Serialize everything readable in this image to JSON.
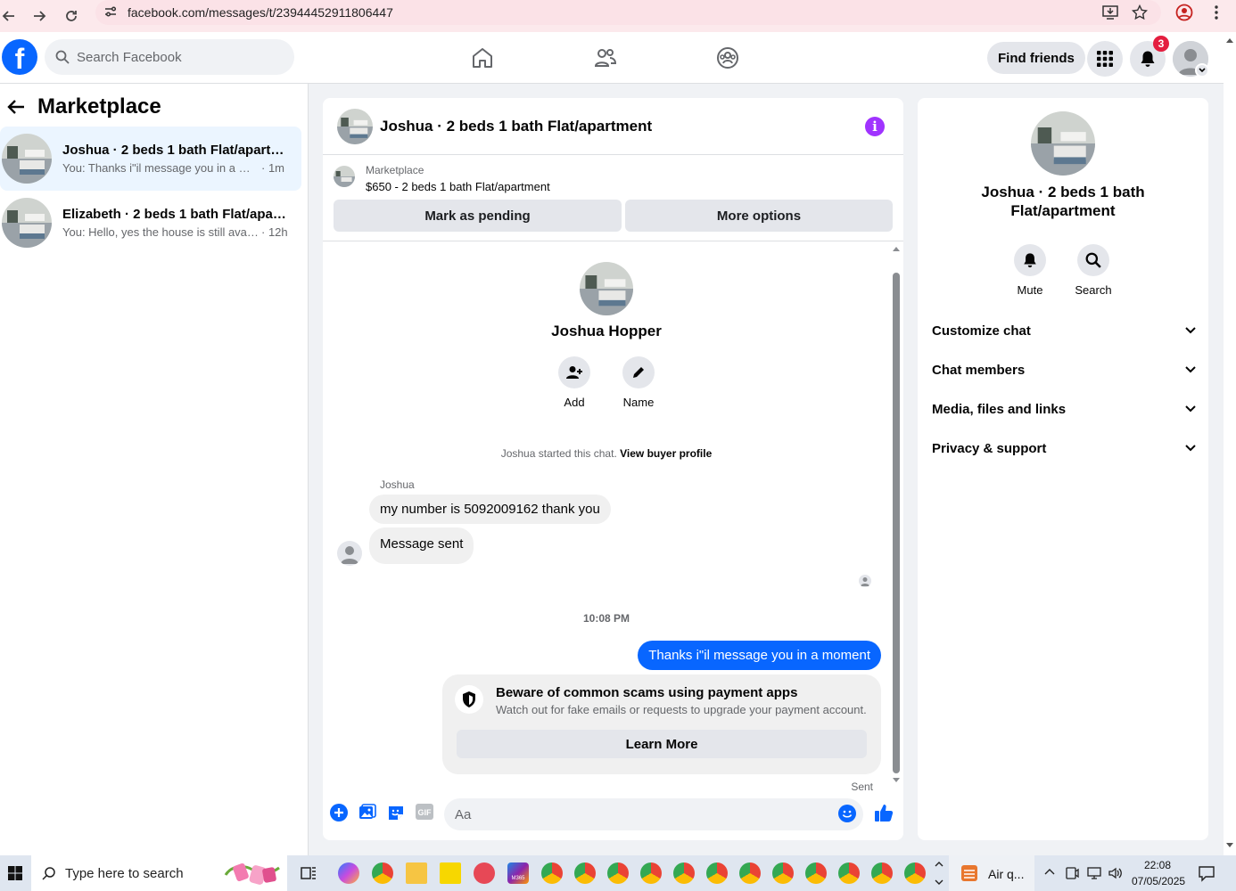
{
  "browser": {
    "url": "facebook.com/messages/t/23944452911806447"
  },
  "topbar": {
    "search_placeholder": "Search Facebook",
    "find_friends": "Find friends",
    "notification_count": "3"
  },
  "sidebar": {
    "title": "Marketplace",
    "conversations": [
      {
        "title": "Joshua · 2 beds 1 bath Flat/apartm...",
        "preview": "You: Thanks i\"il message you in a mo...",
        "time": "· 1m"
      },
      {
        "title": "Elizabeth · 2 beds 1 bath Flat/apart...",
        "preview": "You: Hello, yes the house is still avail...",
        "time": "· 12h"
      }
    ]
  },
  "chat": {
    "title": "Joshua · 2 beds 1 bath Flat/apartment",
    "marketplace_label": "Marketplace",
    "listing": "$650 - 2 beds 1 bath Flat/apartment",
    "mark_pending": "Mark as pending",
    "more_options": "More options",
    "contact_name": "Joshua Hopper",
    "add_label": "Add",
    "name_label": "Name",
    "started_text": "Joshua started this chat.",
    "view_buyer": "View buyer profile",
    "sender": "Joshua",
    "messages_in": [
      "my number is 5092009162 thank you",
      "Message sent"
    ],
    "timestamp": "10:08 PM",
    "message_out": "Thanks i\"il message you in a moment",
    "scam_title": "Beware of common scams using payment apps",
    "scam_desc": "Watch out for fake emails or requests to upgrade your payment account.",
    "learn_more": "Learn More",
    "sent": "Sent",
    "composer_placeholder": "Aa",
    "gif_label": "GIF"
  },
  "info_panel": {
    "name": "Joshua · 2 beds 1 bath Flat/apartment",
    "mute": "Mute",
    "search": "Search",
    "sections": [
      "Customize chat",
      "Chat members",
      "Media, files and links",
      "Privacy & support"
    ]
  },
  "taskbar": {
    "search_placeholder": "Type here to search",
    "weather": "Air q...",
    "time": "22:08",
    "date": "07/05/2025",
    "m365_label": "M365"
  },
  "colors": {
    "brand": "#0866ff",
    "accent_purple": "#a033ff",
    "badge": "#e41e3f"
  }
}
